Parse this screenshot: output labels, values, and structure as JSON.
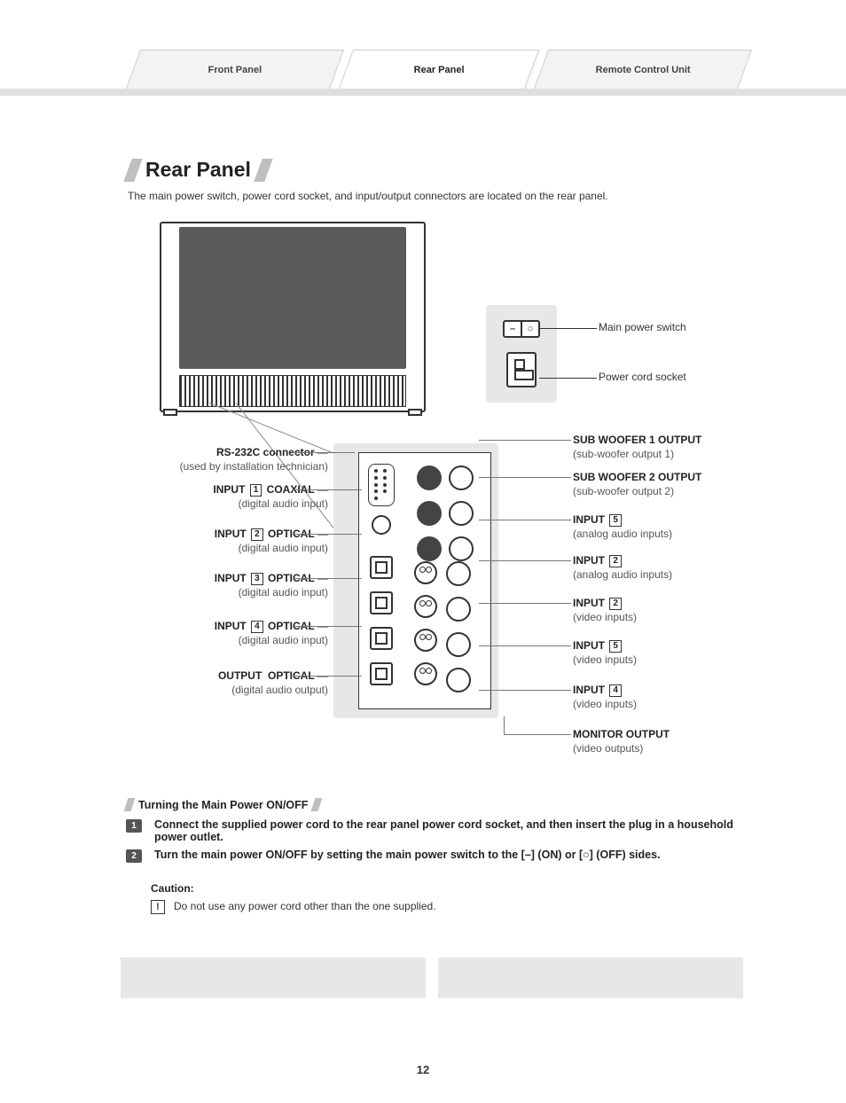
{
  "tabs": {
    "front": "Front Panel",
    "rear": "Rear Panel",
    "remote": "Remote Control Unit"
  },
  "title": "Rear Panel",
  "intro": "The main power switch, power cord socket, and input/output connectors are located on the rear panel.",
  "power": {
    "switch_label": "Main power switch",
    "socket_label": "Power cord socket",
    "switch_on_glyph": "–",
    "switch_off_glyph": "○"
  },
  "left_labels": [
    {
      "title": "RS-232C connector",
      "sub": "(used by installation technician)"
    },
    {
      "title": "INPUT",
      "num": "1",
      "suffix": "COAXIAL",
      "sub": "(digital audio input)"
    },
    {
      "title": "INPUT",
      "num": "2",
      "suffix": "OPTICAL",
      "sub": "(digital audio input)"
    },
    {
      "title": "INPUT",
      "num": "3",
      "suffix": "OPTICAL",
      "sub": "(digital audio input)"
    },
    {
      "title": "INPUT",
      "num": "4",
      "suffix": "OPTICAL",
      "sub": "(digital audio input)"
    },
    {
      "title": "OUTPUT",
      "suffix": "OPTICAL",
      "sub": "(digital audio output)"
    }
  ],
  "right_labels": [
    {
      "title": "SUB WOOFER 1 OUTPUT",
      "sub": "(sub-woofer output 1)"
    },
    {
      "title": "SUB WOOFER 2 OUTPUT",
      "sub": "(sub-woofer output 2)"
    },
    {
      "title": "INPUT",
      "num": "5",
      "sub": "(analog audio inputs)"
    },
    {
      "title": "INPUT",
      "num": "2",
      "sub": "(analog audio inputs)"
    },
    {
      "title": "INPUT",
      "num": "2",
      "sub": "(video inputs)"
    },
    {
      "title": "INPUT",
      "num": "5",
      "sub": "(video inputs)"
    },
    {
      "title": "INPUT",
      "num": "4",
      "sub": "(video inputs)"
    },
    {
      "title": "MONITOR OUTPUT",
      "sub": "(video outputs)"
    }
  ],
  "instructions": {
    "heading": "Turning the Main Power ON/OFF",
    "steps": [
      "Connect the supplied power cord to the rear panel power cord socket, and then insert the plug in a household power outlet.",
      "Turn the main power ON/OFF by setting the main power switch to the [–] (ON) or [○] (OFF) sides."
    ],
    "caution_heading": "Caution:",
    "caution_text": "Do not use any power cord other than the one supplied."
  },
  "page_number": "12"
}
